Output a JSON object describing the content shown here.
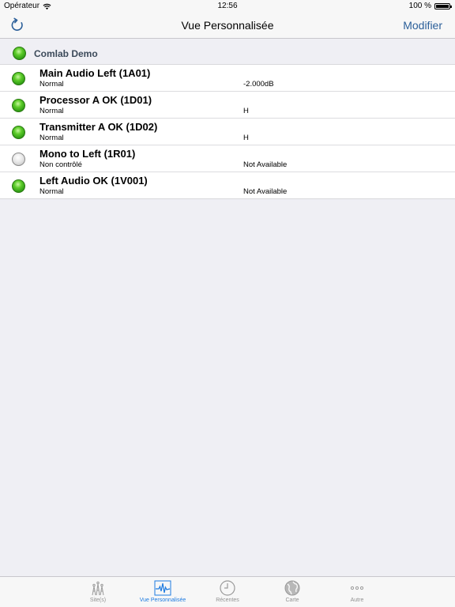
{
  "status_bar": {
    "carrier": "Opérateur",
    "time": "12:56",
    "battery": "100 %"
  },
  "nav": {
    "title": "Vue Personnalisée",
    "modify_label": "Modifier"
  },
  "group": {
    "title": "Comlab Demo",
    "status": "green"
  },
  "rows": [
    {
      "title": "Main Audio Left (1A01)",
      "subtitle": "Normal",
      "value": "-2.000dB",
      "status": "green"
    },
    {
      "title": "Processor A OK (1D01)",
      "subtitle": "Normal",
      "value": "H",
      "status": "green"
    },
    {
      "title": "Transmitter A OK (1D02)",
      "subtitle": "Normal",
      "value": "H",
      "status": "green"
    },
    {
      "title": "Mono to Left (1R01)",
      "subtitle": "Non contrôlé",
      "value": "Not Available",
      "status": "gray"
    },
    {
      "title": "Left Audio OK (1V001)",
      "subtitle": "Normal",
      "value": "Not Available",
      "status": "green"
    }
  ],
  "tabs": [
    {
      "label": "Site(s)",
      "icon": "sites-icon",
      "active": false
    },
    {
      "label": "Vue Personnalisée",
      "icon": "waveform-icon",
      "active": true
    },
    {
      "label": "Récentes",
      "icon": "clock-icon",
      "active": false
    },
    {
      "label": "Carte",
      "icon": "globe-icon",
      "active": false
    },
    {
      "label": "Autre",
      "icon": "more-icon",
      "active": false
    }
  ],
  "colors": {
    "accent": "#1e7be0",
    "status_green": "#3aa81a",
    "status_gray": "#d0d0d0"
  }
}
